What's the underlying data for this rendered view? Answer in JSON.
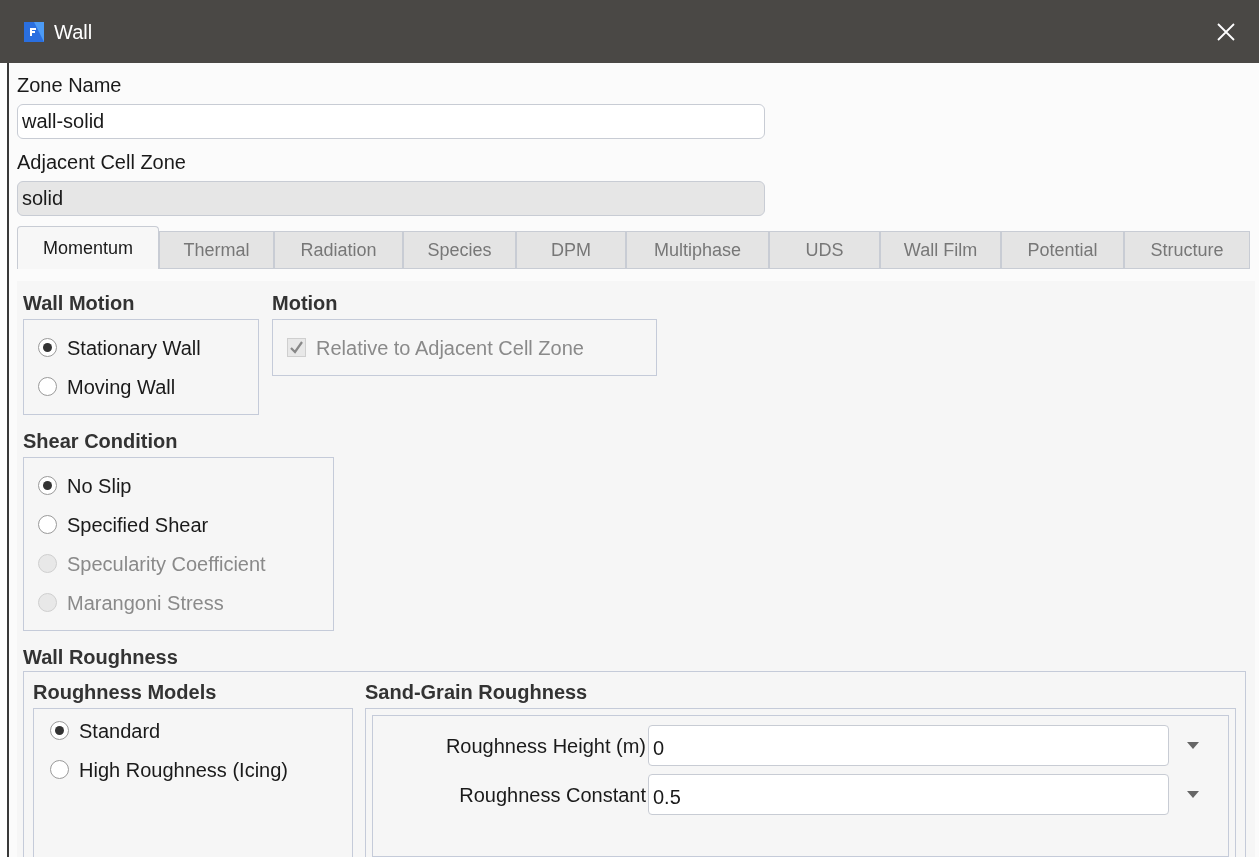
{
  "window": {
    "title": "Wall"
  },
  "zone_name": {
    "label": "Zone Name",
    "value": "wall-solid",
    "disabled": false
  },
  "adjacent_cell_zone": {
    "label": "Adjacent Cell Zone",
    "value": "solid",
    "disabled": true
  },
  "tabs": [
    {
      "label": "Momentum",
      "selected": true
    },
    {
      "label": "Thermal",
      "selected": false
    },
    {
      "label": "Radiation",
      "selected": false
    },
    {
      "label": "Species",
      "selected": false
    },
    {
      "label": "DPM",
      "selected": false
    },
    {
      "label": "Multiphase",
      "selected": false
    },
    {
      "label": "UDS",
      "selected": false
    },
    {
      "label": "Wall Film",
      "selected": false
    },
    {
      "label": "Potential",
      "selected": false
    },
    {
      "label": "Structure",
      "selected": false
    }
  ],
  "wall_motion": {
    "title": "Wall Motion",
    "options": [
      {
        "label": "Stationary Wall",
        "selected": true,
        "disabled": false
      },
      {
        "label": "Moving Wall",
        "selected": false,
        "disabled": false
      }
    ]
  },
  "motion": {
    "title": "Motion",
    "options": [
      {
        "label": "Relative to Adjacent Cell Zone",
        "checked": true,
        "disabled": true
      }
    ]
  },
  "shear_condition": {
    "title": "Shear Condition",
    "options": [
      {
        "label": "No Slip",
        "selected": true,
        "disabled": false
      },
      {
        "label": "Specified Shear",
        "selected": false,
        "disabled": false
      },
      {
        "label": "Specularity Coefficient",
        "selected": false,
        "disabled": true
      },
      {
        "label": "Marangoni Stress",
        "selected": false,
        "disabled": true
      }
    ]
  },
  "wall_roughness": {
    "title": "Wall Roughness",
    "roughness_models": {
      "title": "Roughness Models",
      "options": [
        {
          "label": "Standard",
          "selected": true,
          "disabled": false
        },
        {
          "label": "High Roughness (Icing)",
          "selected": false,
          "disabled": false
        }
      ]
    },
    "sand_grain_roughness": {
      "title": "Sand-Grain Roughness",
      "fields": [
        {
          "label": "Roughness Height (m)",
          "value": "0"
        },
        {
          "label": "Roughness Constant",
          "value": "0.5"
        }
      ]
    }
  }
}
